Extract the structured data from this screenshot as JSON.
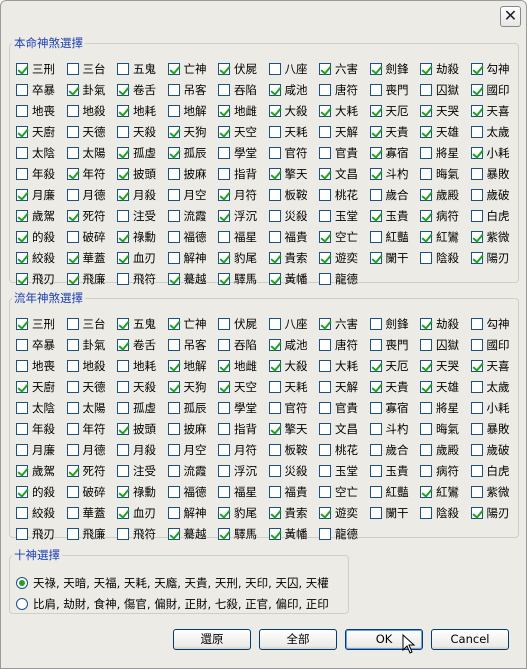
{
  "close_label": "✕",
  "benming": {
    "title": "本命神煞選擇",
    "items": [
      {
        "label": "三刑",
        "checked": true
      },
      {
        "label": "三台",
        "checked": false
      },
      {
        "label": "五鬼",
        "checked": false
      },
      {
        "label": "亡神",
        "checked": true
      },
      {
        "label": "伏屍",
        "checked": true
      },
      {
        "label": "八座",
        "checked": false
      },
      {
        "label": "六害",
        "checked": true
      },
      {
        "label": "劍鋒",
        "checked": true
      },
      {
        "label": "劫殺",
        "checked": true
      },
      {
        "label": "勾神",
        "checked": true
      },
      {
        "label": "卒暴",
        "checked": false
      },
      {
        "label": "卦氣",
        "checked": true
      },
      {
        "label": "卷舌",
        "checked": true
      },
      {
        "label": "吊客",
        "checked": false
      },
      {
        "label": "吞陷",
        "checked": false
      },
      {
        "label": "咸池",
        "checked": true
      },
      {
        "label": "唐符",
        "checked": false
      },
      {
        "label": "喪門",
        "checked": false
      },
      {
        "label": "囚獄",
        "checked": false
      },
      {
        "label": "國印",
        "checked": true
      },
      {
        "label": "地喪",
        "checked": false
      },
      {
        "label": "地殺",
        "checked": false
      },
      {
        "label": "地耗",
        "checked": true
      },
      {
        "label": "地解",
        "checked": false
      },
      {
        "label": "地雌",
        "checked": true
      },
      {
        "label": "大殺",
        "checked": true
      },
      {
        "label": "大耗",
        "checked": true
      },
      {
        "label": "天厄",
        "checked": true
      },
      {
        "label": "天哭",
        "checked": true
      },
      {
        "label": "天喜",
        "checked": true
      },
      {
        "label": "天廚",
        "checked": true
      },
      {
        "label": "天德",
        "checked": false
      },
      {
        "label": "天殺",
        "checked": false
      },
      {
        "label": "天狗",
        "checked": true
      },
      {
        "label": "天空",
        "checked": true
      },
      {
        "label": "天耗",
        "checked": false
      },
      {
        "label": "天解",
        "checked": false
      },
      {
        "label": "天貴",
        "checked": true
      },
      {
        "label": "天雄",
        "checked": true
      },
      {
        "label": "太歲",
        "checked": false
      },
      {
        "label": "太陰",
        "checked": false
      },
      {
        "label": "太陽",
        "checked": false
      },
      {
        "label": "孤虛",
        "checked": true
      },
      {
        "label": "孤辰",
        "checked": true
      },
      {
        "label": "學堂",
        "checked": false
      },
      {
        "label": "官符",
        "checked": false
      },
      {
        "label": "官貴",
        "checked": false
      },
      {
        "label": "寡宿",
        "checked": true
      },
      {
        "label": "將星",
        "checked": false
      },
      {
        "label": "小耗",
        "checked": true
      },
      {
        "label": "年殺",
        "checked": false
      },
      {
        "label": "年符",
        "checked": true
      },
      {
        "label": "披頭",
        "checked": true
      },
      {
        "label": "披麻",
        "checked": false
      },
      {
        "label": "指背",
        "checked": false
      },
      {
        "label": "擎天",
        "checked": true
      },
      {
        "label": "文昌",
        "checked": true
      },
      {
        "label": "斗杓",
        "checked": true
      },
      {
        "label": "晦氣",
        "checked": false
      },
      {
        "label": "暴敗",
        "checked": false
      },
      {
        "label": "月廉",
        "checked": true
      },
      {
        "label": "月德",
        "checked": false
      },
      {
        "label": "月殺",
        "checked": true
      },
      {
        "label": "月空",
        "checked": false
      },
      {
        "label": "月符",
        "checked": true
      },
      {
        "label": "板鞍",
        "checked": false
      },
      {
        "label": "桃花",
        "checked": false
      },
      {
        "label": "歲合",
        "checked": false
      },
      {
        "label": "歲殿",
        "checked": true
      },
      {
        "label": "歲破",
        "checked": false
      },
      {
        "label": "歲駕",
        "checked": true
      },
      {
        "label": "死符",
        "checked": true
      },
      {
        "label": "注受",
        "checked": false
      },
      {
        "label": "流霞",
        "checked": false
      },
      {
        "label": "浮沉",
        "checked": true
      },
      {
        "label": "災殺",
        "checked": false
      },
      {
        "label": "玉堂",
        "checked": false
      },
      {
        "label": "玉貴",
        "checked": true
      },
      {
        "label": "病符",
        "checked": true
      },
      {
        "label": "白虎",
        "checked": false
      },
      {
        "label": "的殺",
        "checked": true
      },
      {
        "label": "破碎",
        "checked": false
      },
      {
        "label": "祿勳",
        "checked": true
      },
      {
        "label": "福德",
        "checked": false
      },
      {
        "label": "福星",
        "checked": false
      },
      {
        "label": "福貴",
        "checked": false
      },
      {
        "label": "空亡",
        "checked": true
      },
      {
        "label": "紅豔",
        "checked": false
      },
      {
        "label": "紅鸞",
        "checked": true
      },
      {
        "label": "紫微",
        "checked": true
      },
      {
        "label": "絞殺",
        "checked": true
      },
      {
        "label": "華蓋",
        "checked": true
      },
      {
        "label": "血刃",
        "checked": true
      },
      {
        "label": "解神",
        "checked": false
      },
      {
        "label": "豹尾",
        "checked": true
      },
      {
        "label": "貴索",
        "checked": true
      },
      {
        "label": "遊奕",
        "checked": true
      },
      {
        "label": "闌干",
        "checked": true
      },
      {
        "label": "陰殺",
        "checked": false
      },
      {
        "label": "陽刃",
        "checked": true
      },
      {
        "label": "飛刃",
        "checked": true
      },
      {
        "label": "飛廉",
        "checked": true
      },
      {
        "label": "飛符",
        "checked": false
      },
      {
        "label": "驀越",
        "checked": true
      },
      {
        "label": "驛馬",
        "checked": true
      },
      {
        "label": "黃幡",
        "checked": true
      },
      {
        "label": "龍德",
        "checked": false
      }
    ]
  },
  "liunian": {
    "title": "流年神煞選擇",
    "items": [
      {
        "label": "三刑",
        "checked": true
      },
      {
        "label": "三台",
        "checked": false
      },
      {
        "label": "五鬼",
        "checked": true
      },
      {
        "label": "亡神",
        "checked": true
      },
      {
        "label": "伏屍",
        "checked": false
      },
      {
        "label": "八座",
        "checked": false
      },
      {
        "label": "六害",
        "checked": true
      },
      {
        "label": "劍鋒",
        "checked": false
      },
      {
        "label": "劫殺",
        "checked": true
      },
      {
        "label": "勾神",
        "checked": false
      },
      {
        "label": "卒暴",
        "checked": false
      },
      {
        "label": "卦氣",
        "checked": false
      },
      {
        "label": "卷舌",
        "checked": true
      },
      {
        "label": "吊客",
        "checked": false
      },
      {
        "label": "吞陷",
        "checked": false
      },
      {
        "label": "咸池",
        "checked": true
      },
      {
        "label": "唐符",
        "checked": false
      },
      {
        "label": "喪門",
        "checked": false
      },
      {
        "label": "囚獄",
        "checked": false
      },
      {
        "label": "國印",
        "checked": false
      },
      {
        "label": "地喪",
        "checked": false
      },
      {
        "label": "地殺",
        "checked": false
      },
      {
        "label": "地耗",
        "checked": false
      },
      {
        "label": "地解",
        "checked": true
      },
      {
        "label": "地雌",
        "checked": true
      },
      {
        "label": "大殺",
        "checked": true
      },
      {
        "label": "大耗",
        "checked": false
      },
      {
        "label": "天厄",
        "checked": true
      },
      {
        "label": "天哭",
        "checked": true
      },
      {
        "label": "天喜",
        "checked": true
      },
      {
        "label": "天廚",
        "checked": true
      },
      {
        "label": "天德",
        "checked": false
      },
      {
        "label": "天殺",
        "checked": false
      },
      {
        "label": "天狗",
        "checked": true
      },
      {
        "label": "天空",
        "checked": true
      },
      {
        "label": "天耗",
        "checked": false
      },
      {
        "label": "天解",
        "checked": false
      },
      {
        "label": "天貴",
        "checked": true
      },
      {
        "label": "天雄",
        "checked": true
      },
      {
        "label": "太歲",
        "checked": false
      },
      {
        "label": "太陰",
        "checked": false
      },
      {
        "label": "太陽",
        "checked": false
      },
      {
        "label": "孤虛",
        "checked": false
      },
      {
        "label": "孤辰",
        "checked": false
      },
      {
        "label": "學堂",
        "checked": false
      },
      {
        "label": "官符",
        "checked": false
      },
      {
        "label": "官貴",
        "checked": false
      },
      {
        "label": "寡宿",
        "checked": false
      },
      {
        "label": "將星",
        "checked": false
      },
      {
        "label": "小耗",
        "checked": false
      },
      {
        "label": "年殺",
        "checked": false
      },
      {
        "label": "年符",
        "checked": false
      },
      {
        "label": "披頭",
        "checked": true
      },
      {
        "label": "披麻",
        "checked": false
      },
      {
        "label": "指背",
        "checked": false
      },
      {
        "label": "擎天",
        "checked": true
      },
      {
        "label": "文昌",
        "checked": false
      },
      {
        "label": "斗杓",
        "checked": false
      },
      {
        "label": "晦氣",
        "checked": false
      },
      {
        "label": "暴敗",
        "checked": false
      },
      {
        "label": "月廉",
        "checked": false
      },
      {
        "label": "月德",
        "checked": false
      },
      {
        "label": "月殺",
        "checked": false
      },
      {
        "label": "月空",
        "checked": false
      },
      {
        "label": "月符",
        "checked": false
      },
      {
        "label": "板鞍",
        "checked": false
      },
      {
        "label": "桃花",
        "checked": false
      },
      {
        "label": "歲合",
        "checked": false
      },
      {
        "label": "歲殿",
        "checked": false
      },
      {
        "label": "歲破",
        "checked": false
      },
      {
        "label": "歲駕",
        "checked": true
      },
      {
        "label": "死符",
        "checked": true
      },
      {
        "label": "注受",
        "checked": false
      },
      {
        "label": "流霞",
        "checked": false
      },
      {
        "label": "浮沉",
        "checked": false
      },
      {
        "label": "災殺",
        "checked": false
      },
      {
        "label": "玉堂",
        "checked": false
      },
      {
        "label": "玉貴",
        "checked": false
      },
      {
        "label": "病符",
        "checked": false
      },
      {
        "label": "白虎",
        "checked": false
      },
      {
        "label": "的殺",
        "checked": true
      },
      {
        "label": "破碎",
        "checked": false
      },
      {
        "label": "祿勳",
        "checked": true
      },
      {
        "label": "福德",
        "checked": false
      },
      {
        "label": "福星",
        "checked": false
      },
      {
        "label": "福貴",
        "checked": false
      },
      {
        "label": "空亡",
        "checked": false
      },
      {
        "label": "紅豔",
        "checked": false
      },
      {
        "label": "紅鸞",
        "checked": true
      },
      {
        "label": "紫微",
        "checked": false
      },
      {
        "label": "絞殺",
        "checked": false
      },
      {
        "label": "華蓋",
        "checked": false
      },
      {
        "label": "血刃",
        "checked": true
      },
      {
        "label": "解神",
        "checked": false
      },
      {
        "label": "豹尾",
        "checked": true
      },
      {
        "label": "貴索",
        "checked": true
      },
      {
        "label": "遊奕",
        "checked": true
      },
      {
        "label": "闌干",
        "checked": false
      },
      {
        "label": "陰殺",
        "checked": false
      },
      {
        "label": "陽刃",
        "checked": true
      },
      {
        "label": "飛刃",
        "checked": false
      },
      {
        "label": "飛廉",
        "checked": false
      },
      {
        "label": "飛符",
        "checked": false
      },
      {
        "label": "驀越",
        "checked": true
      },
      {
        "label": "驛馬",
        "checked": true
      },
      {
        "label": "黃幡",
        "checked": true
      },
      {
        "label": "龍德",
        "checked": false
      }
    ]
  },
  "shishen": {
    "title": "十神選擇",
    "options": [
      {
        "label": "天祿, 天暗, 天福, 天耗, 天廕, 天貴, 天刑, 天印, 天囚, 天權",
        "selected": true
      },
      {
        "label": "比肩, 劫財, 食神, 傷官, 偏財, 正財, 七殺, 正官, 偏印, 正印",
        "selected": false
      }
    ]
  },
  "buttons": {
    "restore": "還原",
    "all": "全部",
    "ok": "OK",
    "cancel": "Cancel"
  }
}
